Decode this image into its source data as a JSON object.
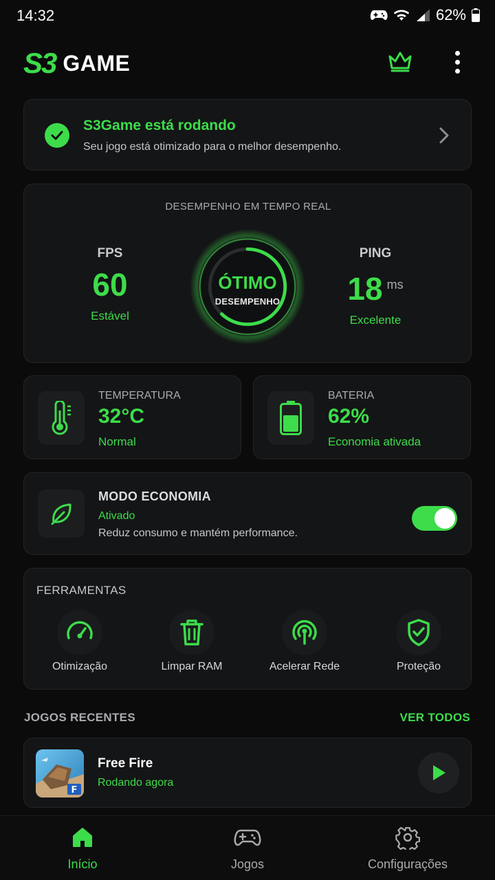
{
  "status_bar": {
    "time": "14:32",
    "battery": "62%"
  },
  "header": {
    "logo_mark": "S3",
    "logo_text": "GAME",
    "premium_icon": "crown-icon",
    "menu_icon": "kebab-menu-icon"
  },
  "status": {
    "title": "S3Game está rodando",
    "subtitle": "Seu jogo está otimizado para o melhor desempenho."
  },
  "performance": {
    "title": "DESEMPENHO EM TEMPO REAL",
    "fps": {
      "label": "FPS",
      "value": "60",
      "status": "Estável"
    },
    "gauge": {
      "main": "ÓTIMO",
      "sub": "DESEMPENHO",
      "level": 0.62
    },
    "ping": {
      "label": "PING",
      "value": "18",
      "unit": "ms",
      "status": "Excelente"
    }
  },
  "temperature": {
    "label": "TEMPERATURA",
    "value": "32°C",
    "status": "Normal"
  },
  "battery": {
    "label": "BATERIA",
    "value": "62%",
    "status": "Economia ativada"
  },
  "economy": {
    "title": "MODO ECONOMIA",
    "status": "Ativado",
    "description": "Reduz consumo e mantém performance.",
    "enabled": true
  },
  "tools": {
    "title": "FERRAMENTAS",
    "items": [
      {
        "label": "Otimização",
        "icon": "speedometer-icon"
      },
      {
        "label": "Limpar RAM",
        "icon": "trash-icon"
      },
      {
        "label": "Acelerar Rede",
        "icon": "network-signal-icon"
      },
      {
        "label": "Proteção",
        "icon": "shield-check-icon"
      }
    ]
  },
  "recent": {
    "title": "JOGOS RECENTES",
    "see_all": "VER TODOS",
    "games": [
      {
        "name": "Free Fire",
        "status": "Rodando agora"
      }
    ]
  },
  "nav": {
    "items": [
      {
        "label": "Início",
        "icon": "home-icon",
        "active": true
      },
      {
        "label": "Jogos",
        "icon": "gamepad-icon",
        "active": false
      },
      {
        "label": "Configurações",
        "icon": "gear-icon",
        "active": false
      }
    ]
  },
  "colors": {
    "accent": "#3ddc4a",
    "background": "#0b0b0c",
    "card": "#141516"
  }
}
